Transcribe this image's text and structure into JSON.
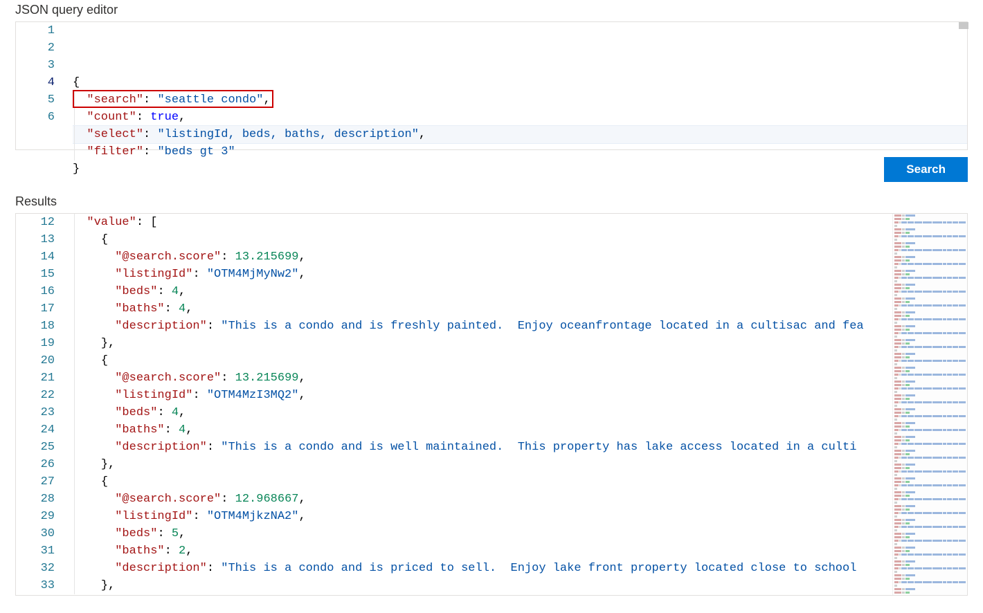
{
  "labels": {
    "query_editor_title": "JSON query editor",
    "results_title": "Results",
    "search_button": "Search"
  },
  "query_editor": {
    "highlighted_line_index": 3,
    "annotation_line_index": 4,
    "lines": [
      {
        "n": "1",
        "tokens": [
          {
            "t": "{",
            "c": "brace"
          }
        ]
      },
      {
        "n": "2",
        "tokens": [
          {
            "t": "  ",
            "c": "plain"
          },
          {
            "t": "\"search\"",
            "c": "key"
          },
          {
            "t": ": ",
            "c": "punct"
          },
          {
            "t": "\"seattle condo\"",
            "c": "string"
          },
          {
            "t": ",",
            "c": "punct"
          }
        ]
      },
      {
        "n": "3",
        "tokens": [
          {
            "t": "  ",
            "c": "plain"
          },
          {
            "t": "\"count\"",
            "c": "key"
          },
          {
            "t": ": ",
            "c": "punct"
          },
          {
            "t": "true",
            "c": "bool"
          },
          {
            "t": ",",
            "c": "punct"
          }
        ]
      },
      {
        "n": "4",
        "tokens": [
          {
            "t": "  ",
            "c": "plain"
          },
          {
            "t": "\"select\"",
            "c": "key"
          },
          {
            "t": ": ",
            "c": "punct"
          },
          {
            "t": "\"listingId, beds, baths, description\"",
            "c": "string"
          },
          {
            "t": ",",
            "c": "punct"
          }
        ]
      },
      {
        "n": "5",
        "tokens": [
          {
            "t": "  ",
            "c": "plain"
          },
          {
            "t": "\"filter\"",
            "c": "key"
          },
          {
            "t": ": ",
            "c": "punct"
          },
          {
            "t": "\"beds gt 3\"",
            "c": "string"
          }
        ]
      },
      {
        "n": "6",
        "tokens": [
          {
            "t": "}",
            "c": "brace"
          }
        ]
      }
    ]
  },
  "results_editor": {
    "lines": [
      {
        "n": "12",
        "indent": 1,
        "tokens": [
          {
            "t": "\"value\"",
            "c": "key"
          },
          {
            "t": ": [",
            "c": "punct"
          }
        ]
      },
      {
        "n": "13",
        "indent": 2,
        "tokens": [
          {
            "t": "{",
            "c": "brace"
          }
        ]
      },
      {
        "n": "14",
        "indent": 3,
        "tokens": [
          {
            "t": "\"@search.score\"",
            "c": "key"
          },
          {
            "t": ": ",
            "c": "punct"
          },
          {
            "t": "13.215699",
            "c": "number"
          },
          {
            "t": ",",
            "c": "punct"
          }
        ]
      },
      {
        "n": "15",
        "indent": 3,
        "tokens": [
          {
            "t": "\"listingId\"",
            "c": "key"
          },
          {
            "t": ": ",
            "c": "punct"
          },
          {
            "t": "\"OTM4MjMyNw2\"",
            "c": "string"
          },
          {
            "t": ",",
            "c": "punct"
          }
        ]
      },
      {
        "n": "16",
        "indent": 3,
        "tokens": [
          {
            "t": "\"beds\"",
            "c": "key"
          },
          {
            "t": ": ",
            "c": "punct"
          },
          {
            "t": "4",
            "c": "number"
          },
          {
            "t": ",",
            "c": "punct"
          }
        ]
      },
      {
        "n": "17",
        "indent": 3,
        "tokens": [
          {
            "t": "\"baths\"",
            "c": "key"
          },
          {
            "t": ": ",
            "c": "punct"
          },
          {
            "t": "4",
            "c": "number"
          },
          {
            "t": ",",
            "c": "punct"
          }
        ]
      },
      {
        "n": "18",
        "indent": 3,
        "tokens": [
          {
            "t": "\"description\"",
            "c": "key"
          },
          {
            "t": ": ",
            "c": "punct"
          },
          {
            "t": "\"This is a condo and is freshly painted.  Enjoy oceanfrontage located in a cultisac and fea",
            "c": "string"
          }
        ]
      },
      {
        "n": "19",
        "indent": 2,
        "tokens": [
          {
            "t": "},",
            "c": "brace"
          }
        ]
      },
      {
        "n": "20",
        "indent": 2,
        "tokens": [
          {
            "t": "{",
            "c": "brace"
          }
        ]
      },
      {
        "n": "21",
        "indent": 3,
        "tokens": [
          {
            "t": "\"@search.score\"",
            "c": "key"
          },
          {
            "t": ": ",
            "c": "punct"
          },
          {
            "t": "13.215699",
            "c": "number"
          },
          {
            "t": ",",
            "c": "punct"
          }
        ]
      },
      {
        "n": "22",
        "indent": 3,
        "tokens": [
          {
            "t": "\"listingId\"",
            "c": "key"
          },
          {
            "t": ": ",
            "c": "punct"
          },
          {
            "t": "\"OTM4MzI3MQ2\"",
            "c": "string"
          },
          {
            "t": ",",
            "c": "punct"
          }
        ]
      },
      {
        "n": "23",
        "indent": 3,
        "tokens": [
          {
            "t": "\"beds\"",
            "c": "key"
          },
          {
            "t": ": ",
            "c": "punct"
          },
          {
            "t": "4",
            "c": "number"
          },
          {
            "t": ",",
            "c": "punct"
          }
        ]
      },
      {
        "n": "24",
        "indent": 3,
        "tokens": [
          {
            "t": "\"baths\"",
            "c": "key"
          },
          {
            "t": ": ",
            "c": "punct"
          },
          {
            "t": "4",
            "c": "number"
          },
          {
            "t": ",",
            "c": "punct"
          }
        ]
      },
      {
        "n": "25",
        "indent": 3,
        "tokens": [
          {
            "t": "\"description\"",
            "c": "key"
          },
          {
            "t": ": ",
            "c": "punct"
          },
          {
            "t": "\"This is a condo and is well maintained.  This property has lake access located in a culti",
            "c": "string"
          }
        ]
      },
      {
        "n": "26",
        "indent": 2,
        "tokens": [
          {
            "t": "},",
            "c": "brace"
          }
        ]
      },
      {
        "n": "27",
        "indent": 2,
        "tokens": [
          {
            "t": "{",
            "c": "brace"
          }
        ]
      },
      {
        "n": "28",
        "indent": 3,
        "tokens": [
          {
            "t": "\"@search.score\"",
            "c": "key"
          },
          {
            "t": ": ",
            "c": "punct"
          },
          {
            "t": "12.968667",
            "c": "number"
          },
          {
            "t": ",",
            "c": "punct"
          }
        ]
      },
      {
        "n": "29",
        "indent": 3,
        "tokens": [
          {
            "t": "\"listingId\"",
            "c": "key"
          },
          {
            "t": ": ",
            "c": "punct"
          },
          {
            "t": "\"OTM4MjkzNA2\"",
            "c": "string"
          },
          {
            "t": ",",
            "c": "punct"
          }
        ]
      },
      {
        "n": "30",
        "indent": 3,
        "tokens": [
          {
            "t": "\"beds\"",
            "c": "key"
          },
          {
            "t": ": ",
            "c": "punct"
          },
          {
            "t": "5",
            "c": "number"
          },
          {
            "t": ",",
            "c": "punct"
          }
        ]
      },
      {
        "n": "31",
        "indent": 3,
        "tokens": [
          {
            "t": "\"baths\"",
            "c": "key"
          },
          {
            "t": ": ",
            "c": "punct"
          },
          {
            "t": "2",
            "c": "number"
          },
          {
            "t": ",",
            "c": "punct"
          }
        ]
      },
      {
        "n": "32",
        "indent": 3,
        "tokens": [
          {
            "t": "\"description\"",
            "c": "key"
          },
          {
            "t": ": ",
            "c": "punct"
          },
          {
            "t": "\"This is a condo and is priced to sell.  Enjoy lake front property located close to school",
            "c": "string"
          }
        ]
      },
      {
        "n": "33",
        "indent": 2,
        "tokens": [
          {
            "t": "},",
            "c": "brace"
          }
        ]
      }
    ]
  }
}
